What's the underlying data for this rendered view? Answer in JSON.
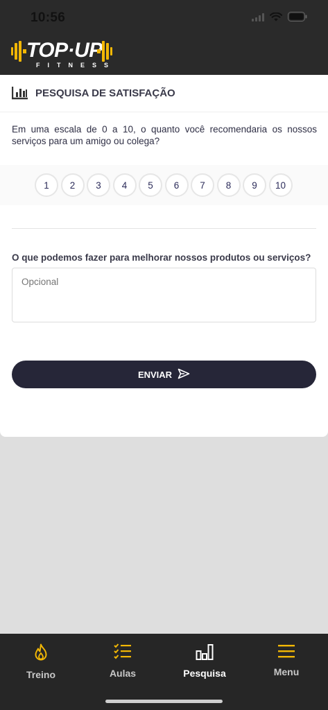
{
  "status_bar": {
    "time": "10:56"
  },
  "brand": {
    "name": "TOP·UP",
    "tagline": "FITNESS",
    "accent": "#f2b705"
  },
  "survey": {
    "title": "PESQUISA DE SATISFAÇÃO",
    "question_scale": "Em uma escala de 0 a 10, o quanto você recomendaria os nossos serviços para um amigo ou colega?",
    "scale_options": [
      "1",
      "2",
      "3",
      "4",
      "5",
      "6",
      "7",
      "8",
      "9",
      "10"
    ],
    "question_improve": "O que podemos fazer para melhorar nossos produtos ou serviços?",
    "improve_placeholder": "Opcional",
    "improve_value": "",
    "submit_label": "ENVIAR"
  },
  "nav": {
    "items": [
      {
        "label": "Treino",
        "icon": "flame-icon"
      },
      {
        "label": "Aulas",
        "icon": "checklist-icon"
      },
      {
        "label": "Pesquisa",
        "icon": "bar-chart-icon",
        "active": true
      },
      {
        "label": "Menu",
        "icon": "hamburger-icon"
      }
    ]
  }
}
